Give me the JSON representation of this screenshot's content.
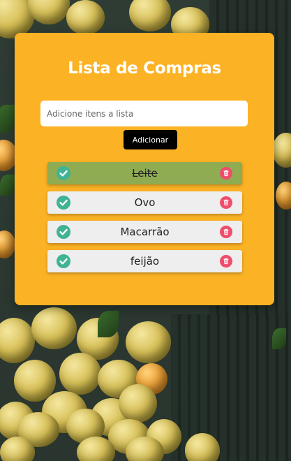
{
  "app": {
    "title": "Lista de Compras"
  },
  "form": {
    "input_placeholder": "Adicione itens a lista",
    "input_value": "",
    "add_label": "Adicionar"
  },
  "items": [
    {
      "label": "Leite",
      "done": true
    },
    {
      "label": "Ovo",
      "done": false
    },
    {
      "label": "Macarrão",
      "done": false
    },
    {
      "label": "feijão",
      "done": false
    }
  ],
  "icons": {
    "check": "check-circle-icon",
    "delete": "trash-icon"
  },
  "colors": {
    "card": "#fbb225",
    "item": "#eeeeee",
    "item_done": "#8fac52",
    "check": "#3fb394",
    "delete": "#ef4d6b",
    "button": "#000000",
    "title": "#ffffff"
  }
}
